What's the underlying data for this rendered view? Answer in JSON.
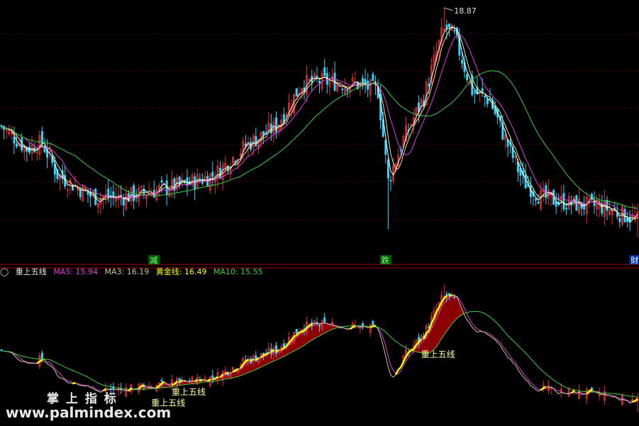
{
  "chart_data": [
    {
      "type": "candlestick",
      "title": "",
      "ylim": [
        11.6,
        19.0
      ],
      "high_label": "18.87",
      "markers": [
        {
          "bar": 60,
          "label": "减"
        },
        {
          "bar": 151,
          "label": "跌"
        },
        {
          "bar": 249,
          "label": "财"
        }
      ],
      "seeds": [
        [
          0,
          15.2
        ],
        [
          10,
          14.5
        ],
        [
          16,
          14.7
        ],
        [
          22,
          13.7
        ],
        [
          36,
          13.0
        ],
        [
          48,
          13.0
        ],
        [
          60,
          13.2
        ],
        [
          72,
          13.4
        ],
        [
          84,
          13.7
        ],
        [
          96,
          14.6
        ],
        [
          108,
          15.2
        ],
        [
          118,
          16.5
        ],
        [
          125,
          16.6
        ],
        [
          140,
          16.5
        ],
        [
          148,
          16.3
        ],
        [
          152,
          13.5
        ],
        [
          158,
          14.8
        ],
        [
          166,
          16.1
        ],
        [
          174,
          18.3
        ],
        [
          178,
          18.0
        ],
        [
          185,
          16.3
        ],
        [
          192,
          16.0
        ],
        [
          198,
          14.8
        ],
        [
          205,
          13.5
        ],
        [
          212,
          13.0
        ],
        [
          224,
          12.8
        ],
        [
          236,
          12.7
        ],
        [
          250,
          12.3
        ]
      ],
      "series": [
        {
          "name": "MA3",
          "period": 3,
          "color": "#ffffff"
        },
        {
          "name": "MA5",
          "period": 5,
          "color": "#e8e890"
        },
        {
          "name": "MA10",
          "period": 10,
          "color": "#e040e0"
        },
        {
          "name": "MA30",
          "period": 30,
          "color": "#40d040"
        }
      ],
      "colors": {
        "up": "#e03030",
        "down": "#30d8ff"
      }
    },
    {
      "type": "indicator",
      "title": "重上五线",
      "legend": [
        {
          "label": "MA5: 15.94",
          "color": "#e040e0"
        },
        {
          "label": "MA3: 16.19",
          "color": "#c8c890"
        },
        {
          "label": "黄金线: 16.49",
          "color": "#ffff00"
        },
        {
          "label": "MA10: 15.55",
          "color": "#40d040"
        }
      ],
      "signals": [
        {
          "bar": 60,
          "label": "重上五线"
        },
        {
          "bar": 68,
          "label": "重上五线"
        },
        {
          "bar": 166,
          "label": "重上五线"
        }
      ],
      "fill_color": "#8b0000",
      "golden_color": "#ffff00"
    }
  ],
  "watermark": {
    "line1": "掌 上 指 标",
    "line2": "www.palmindex.com"
  }
}
